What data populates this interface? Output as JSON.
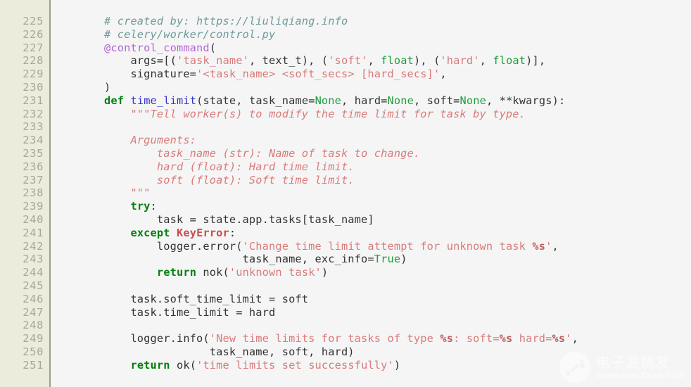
{
  "editor": {
    "language": "python",
    "first_line_number": 225,
    "last_line_number": 251,
    "gutter_bg": "#ECECDD",
    "code_bg": "#F5F5F5",
    "lineno_color": "#A8A89A"
  },
  "colors": {
    "comment": "#6F9A9A",
    "decorator": "#B265D6",
    "keyword": "#007F0E",
    "builtin": "#1E9E3C",
    "function": "#3333CC",
    "string": "#D97B7B",
    "exception": "#CC4C4C",
    "plain": "#333333"
  },
  "line_numbers": [
    "225",
    "226",
    "227",
    "228",
    "229",
    "230",
    "231",
    "232",
    "233",
    "234",
    "235",
    "236",
    "237",
    "238",
    "239",
    "240",
    "241",
    "242",
    "243",
    "244",
    "245",
    "246",
    "247",
    "248",
    "249",
    "250",
    "251"
  ],
  "code_lines": [
    {
      "n": "225",
      "tokens": [
        {
          "c": "t-comment",
          "t": "# created by: https://liuliqiang.info"
        }
      ]
    },
    {
      "n": "226",
      "tokens": [
        {
          "c": "t-comment",
          "t": "# celery/worker/control.py"
        }
      ]
    },
    {
      "n": "227",
      "tokens": [
        {
          "c": "t-decor",
          "t": "@control_command"
        },
        {
          "c": "t-plain",
          "t": "("
        }
      ]
    },
    {
      "n": "228",
      "tokens": [
        {
          "c": "t-plain",
          "t": "    args=[("
        },
        {
          "c": "t-str",
          "t": "'task_name'"
        },
        {
          "c": "t-plain",
          "t": ", text_t), ("
        },
        {
          "c": "t-str",
          "t": "'soft'"
        },
        {
          "c": "t-plain",
          "t": ", "
        },
        {
          "c": "t-builtin",
          "t": "float"
        },
        {
          "c": "t-plain",
          "t": "), ("
        },
        {
          "c": "t-str",
          "t": "'hard'"
        },
        {
          "c": "t-plain",
          "t": ", "
        },
        {
          "c": "t-builtin",
          "t": "float"
        },
        {
          "c": "t-plain",
          "t": ")],"
        }
      ]
    },
    {
      "n": "229",
      "tokens": [
        {
          "c": "t-plain",
          "t": "    signature="
        },
        {
          "c": "t-str",
          "t": "'<task_name> <soft_secs> [hard_secs]'"
        },
        {
          "c": "t-plain",
          "t": ","
        }
      ]
    },
    {
      "n": "230",
      "tokens": [
        {
          "c": "t-plain",
          "t": ")"
        }
      ]
    },
    {
      "n": "231",
      "tokens": [
        {
          "c": "t-kw",
          "t": "def"
        },
        {
          "c": "t-plain",
          "t": " "
        },
        {
          "c": "t-func",
          "t": "time_limit"
        },
        {
          "c": "t-plain",
          "t": "(state, task_name="
        },
        {
          "c": "t-builtin",
          "t": "None"
        },
        {
          "c": "t-plain",
          "t": ", hard="
        },
        {
          "c": "t-builtin",
          "t": "None"
        },
        {
          "c": "t-plain",
          "t": ", soft="
        },
        {
          "c": "t-builtin",
          "t": "None"
        },
        {
          "c": "t-plain",
          "t": ", **kwargs):"
        }
      ]
    },
    {
      "n": "232",
      "tokens": [
        {
          "c": "t-doc",
          "t": "    \"\"\"Tell worker(s) to modify the time limit for task by type."
        }
      ]
    },
    {
      "n": "233",
      "tokens": [
        {
          "c": "t-doc",
          "t": ""
        }
      ]
    },
    {
      "n": "234",
      "tokens": [
        {
          "c": "t-doc",
          "t": "    Arguments:"
        }
      ]
    },
    {
      "n": "235",
      "tokens": [
        {
          "c": "t-doc",
          "t": "        task_name (str): Name of task to change."
        }
      ]
    },
    {
      "n": "236",
      "tokens": [
        {
          "c": "t-doc",
          "t": "        hard (float): Hard time limit."
        }
      ]
    },
    {
      "n": "237",
      "tokens": [
        {
          "c": "t-doc",
          "t": "        soft (float): Soft time limit."
        }
      ]
    },
    {
      "n": "238",
      "tokens": [
        {
          "c": "t-doc",
          "t": "    \"\"\""
        }
      ]
    },
    {
      "n": "239",
      "tokens": [
        {
          "c": "t-plain",
          "t": "    "
        },
        {
          "c": "t-kw",
          "t": "try"
        },
        {
          "c": "t-plain",
          "t": ":"
        }
      ]
    },
    {
      "n": "240",
      "tokens": [
        {
          "c": "t-plain",
          "t": "        task = state.app.tasks[task_name]"
        }
      ]
    },
    {
      "n": "241",
      "tokens": [
        {
          "c": "t-plain",
          "t": "    "
        },
        {
          "c": "t-kw",
          "t": "except"
        },
        {
          "c": "t-plain",
          "t": " "
        },
        {
          "c": "t-exc",
          "t": "KeyError"
        },
        {
          "c": "t-plain",
          "t": ":"
        }
      ]
    },
    {
      "n": "242",
      "tokens": [
        {
          "c": "t-plain",
          "t": "        logger.error("
        },
        {
          "c": "t-str",
          "t": "'Change time limit attempt for unknown task "
        },
        {
          "c": "t-fmt",
          "t": "%s"
        },
        {
          "c": "t-str",
          "t": "'"
        },
        {
          "c": "t-plain",
          "t": ","
        }
      ]
    },
    {
      "n": "243",
      "tokens": [
        {
          "c": "t-plain",
          "t": "                     task_name, exc_info="
        },
        {
          "c": "t-builtin",
          "t": "True"
        },
        {
          "c": "t-plain",
          "t": ")"
        }
      ]
    },
    {
      "n": "244",
      "tokens": [
        {
          "c": "t-plain",
          "t": "        "
        },
        {
          "c": "t-kw",
          "t": "return"
        },
        {
          "c": "t-plain",
          "t": " nok("
        },
        {
          "c": "t-str",
          "t": "'unknown task'"
        },
        {
          "c": "t-plain",
          "t": ")"
        }
      ]
    },
    {
      "n": "245",
      "tokens": [
        {
          "c": "t-plain",
          "t": ""
        }
      ]
    },
    {
      "n": "246",
      "tokens": [
        {
          "c": "t-plain",
          "t": "    task.soft_time_limit = soft"
        }
      ]
    },
    {
      "n": "247",
      "tokens": [
        {
          "c": "t-plain",
          "t": "    task.time_limit = hard"
        }
      ]
    },
    {
      "n": "248",
      "tokens": [
        {
          "c": "t-plain",
          "t": ""
        }
      ]
    },
    {
      "n": "249",
      "tokens": [
        {
          "c": "t-plain",
          "t": "    logger.info("
        },
        {
          "c": "t-str",
          "t": "'New time limits for tasks of type "
        },
        {
          "c": "t-fmt",
          "t": "%s"
        },
        {
          "c": "t-str",
          "t": ": soft="
        },
        {
          "c": "t-fmt",
          "t": "%s"
        },
        {
          "c": "t-str",
          "t": " hard="
        },
        {
          "c": "t-fmt",
          "t": "%s"
        },
        {
          "c": "t-str",
          "t": "'"
        },
        {
          "c": "t-plain",
          "t": ","
        }
      ]
    },
    {
      "n": "250",
      "tokens": [
        {
          "c": "t-plain",
          "t": "                task_name, soft, hard)"
        }
      ]
    },
    {
      "n": "251",
      "tokens": [
        {
          "c": "t-plain",
          "t": "    "
        },
        {
          "c": "t-kw",
          "t": "return"
        },
        {
          "c": "t-plain",
          "t": " ok("
        },
        {
          "c": "t-str",
          "t": "'time limits set successfully'"
        },
        {
          "c": "t-plain",
          "t": ")"
        }
      ]
    }
  ],
  "watermark": {
    "cn_text": "电子发烧友",
    "en_text": "www.elecfans.com"
  }
}
